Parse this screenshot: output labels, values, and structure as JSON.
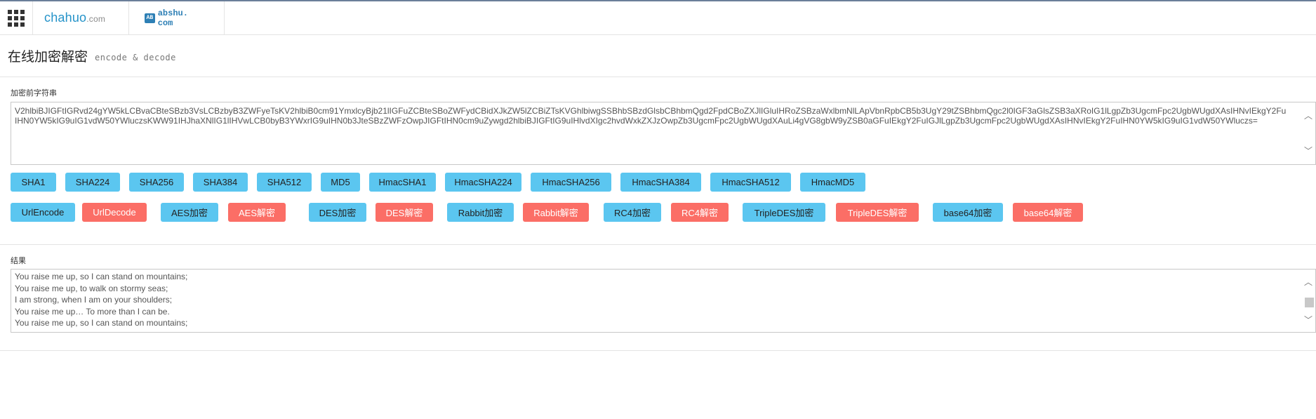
{
  "header": {
    "sites": [
      {
        "name": "chahuo",
        "suffix": ".com"
      },
      {
        "badge": "AB",
        "name": "abshu. com"
      }
    ]
  },
  "page": {
    "title": "在线加密解密",
    "subtitle": "encode & decode"
  },
  "input": {
    "label": "加密前字符串",
    "value": "V2hlbiBJIGFtIGRvd24gYW5kLCBvaCBteSBzb3VsLCBzbyB3ZWFyeTsKV2hlbiB0cm91YmxlcyBjb21lIGFuZCBteSBoZWFydCBidXJkZW5lZCBiZTsKVGhlbiwgSSBhbSBzdGlsbCBhbmQgd2FpdCBoZXJlIGluIHRoZSBzaWxlbmNlLApVbnRpbCB5b3UgY29tZSBhbmQgc2l0IGF3aGlsZSB3aXRoIG1lLgpZb3UgcmFpc2UgbWUgdXAsIHNvIEkgY2FuIHN0YW5kIG9uIG1vdW50YWluczsKWW91IHJhaXNlIG1lIHVwLCB0byB3YWxrIG9uIHN0b3JteSBzZWFzOwpJIGFtIHN0cm9uZywgd2hlbiBJIGFtIG9uIHlvdXIgc2hvdWxkZXJzOwpZb3UgcmFpc2UgbWUgdXAuLi4gVG8gbW9yZSB0aGFuIEkgY2FuIGJlLgpZb3UgcmFpc2UgbWUgdXAsIHNvIEkgY2FuIHN0YW5kIG9uIG1vdW50YWluczs="
  },
  "hash_buttons": [
    "SHA1",
    "SHA224",
    "SHA256",
    "SHA384",
    "SHA512",
    "MD5",
    "HmacSHA1",
    "HmacSHA224",
    "HmacSHA256",
    "HmacSHA384",
    "HmacSHA512",
    "HmacMD5"
  ],
  "cipher_buttons": [
    {
      "label": "UrlEncode",
      "kind": "encrypt"
    },
    {
      "label": "UrlDecode",
      "kind": "decrypt"
    },
    {
      "label": "AES加密",
      "kind": "encrypt"
    },
    {
      "label": "AES解密",
      "kind": "decrypt"
    },
    {
      "label": "DES加密",
      "kind": "encrypt"
    },
    {
      "label": "DES解密",
      "kind": "decrypt"
    },
    {
      "label": "Rabbit加密",
      "kind": "encrypt"
    },
    {
      "label": "Rabbit解密",
      "kind": "decrypt"
    },
    {
      "label": "RC4加密",
      "kind": "encrypt"
    },
    {
      "label": "RC4解密",
      "kind": "decrypt"
    },
    {
      "label": "TripleDES加密",
      "kind": "encrypt"
    },
    {
      "label": "TripleDES解密",
      "kind": "decrypt"
    },
    {
      "label": "base64加密",
      "kind": "encrypt"
    },
    {
      "label": "base64解密",
      "kind": "decrypt"
    }
  ],
  "result": {
    "label": "结果",
    "lines": [
      "You raise me up, so I can stand on mountains;",
      "You raise me up, to walk on stormy seas;",
      "I am strong, when I am on your shoulders;",
      "You raise me up… To more than I can be.",
      "You raise me up, so I can stand on mountains;"
    ]
  },
  "colors": {
    "encrypt": "#5bc6f0",
    "decrypt": "#fb6e66",
    "logo": "#2593c9"
  },
  "icons": {
    "menu": "grid-menu-icon",
    "up": "chevron-up-icon",
    "down": "chevron-down-icon"
  }
}
